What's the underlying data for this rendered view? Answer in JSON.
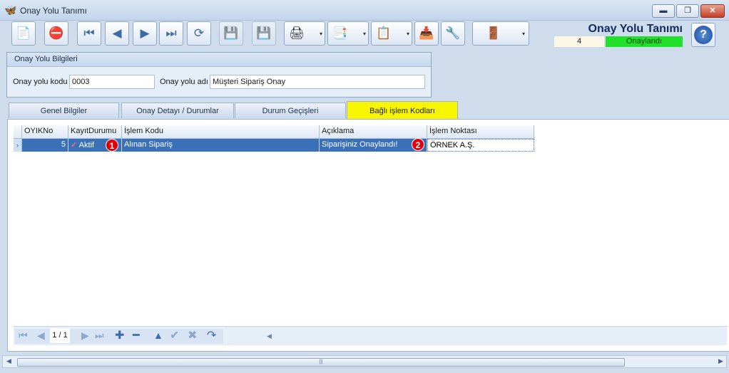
{
  "window": {
    "title": "Onay Yolu Tanımı",
    "minimize": "▬",
    "restore": "❐",
    "close": "✕"
  },
  "toolbar": {
    "buttons": [
      {
        "name": "new-document-button",
        "icon": "📄"
      },
      {
        "name": "delete-document-button",
        "icon": "⛔"
      },
      {
        "name": "first-record-button",
        "icon": "⏮"
      },
      {
        "name": "previous-record-button",
        "icon": "◀"
      },
      {
        "name": "next-record-button",
        "icon": "▶"
      },
      {
        "name": "last-record-button",
        "icon": "⏭"
      },
      {
        "name": "refresh-button",
        "icon": "⟳"
      },
      {
        "name": "save-button",
        "icon": "💾"
      },
      {
        "name": "cancel-save-button",
        "icon": "💾"
      },
      {
        "name": "print-button",
        "icon": "🖨"
      },
      {
        "name": "pdf-export-button",
        "icon": "📑"
      },
      {
        "name": "export-button",
        "icon": "📋"
      },
      {
        "name": "import-button",
        "icon": "📥"
      },
      {
        "name": "tools-button",
        "icon": "🔧"
      },
      {
        "name": "exit-button",
        "icon": "🚪"
      }
    ],
    "dropdown_arrow": "▾"
  },
  "header": {
    "title": "Onay Yolu Tanımı",
    "record_number": "4",
    "status": "Onaylandı",
    "help": "?"
  },
  "info_group": {
    "title": "Onay Yolu Bilgileri",
    "code_label": "Onay yolu kodu",
    "code_value": "0003",
    "name_label": "Onay yolu adı",
    "name_value": "Müşteri Sipariş Onay"
  },
  "tabs": [
    "Genel Bilgiler",
    "Onay Detayı / Durumlar",
    "Durum Geçişleri",
    "Bağlı işlem Kodları"
  ],
  "grid": {
    "columns": [
      "OYIKNo",
      "KayıtDurumu",
      "İşlem Kodu",
      "Açıklama",
      "İşlem Noktası"
    ],
    "rows": [
      {
        "oyikno": "5",
        "check": "✓",
        "durum": "Aktif",
        "islem_kodu": "Alınan Sipariş",
        "aciklama": "Siparişiniz Onaylandı!",
        "islem_noktasi": "ÖRNEK A.Ş."
      }
    ],
    "row_indicator": "›",
    "badges": [
      "1",
      "2"
    ]
  },
  "navigator": {
    "first": "⏮",
    "prev": "◀",
    "position": "1 / 1",
    "next": "▶",
    "last": "⏭",
    "add": "✚",
    "remove": "━",
    "up": "▲",
    "confirm": "✔",
    "cancel": "✖",
    "refresh": "↷",
    "scroll_left": "◀"
  },
  "scrollbar": {
    "left_arrow": "◀",
    "right_arrow": "▶",
    "grip": "|||"
  },
  "colors": {
    "accent": "#14295e",
    "status_bg": "#22e02a",
    "active_tab": "#f7f500",
    "selected_row": "#3a70b8",
    "badge": "#e0000a"
  }
}
